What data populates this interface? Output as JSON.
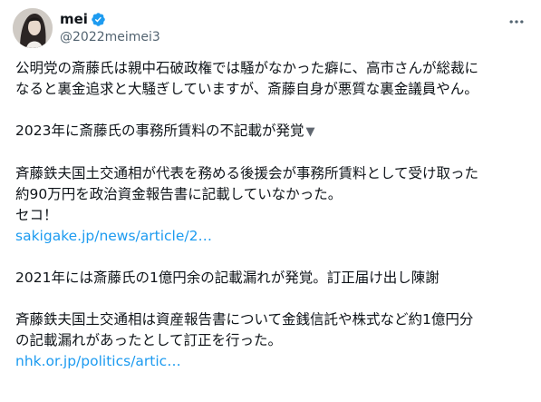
{
  "author": {
    "display_name": "mei",
    "handle": "@2022meimei3"
  },
  "colors": {
    "text": "#0f1419",
    "secondary": "#536471",
    "link": "#1d9bf0",
    "verified": "#1d9bf0"
  },
  "icons": {
    "verified": "verified-badge-icon",
    "more": "more-options-icon",
    "triangle": "down-triangle-icon"
  },
  "post": {
    "para1_line1": "公明党の斎藤氏は親中石破政権では騒がなかった癖に、高市さんが総裁に",
    "para1_line2": "なると裏金追求と大騒ぎしていますが、斎藤自身が悪質な裏金議員やん。",
    "para2_line1": "2023年に斎藤氏の事務所賃料の不記載が発覚",
    "para3_line1": "斉藤鉄夫国土交通相が代表を務める後援会が事務所賃料として受け取った",
    "para3_line2": "約90万円を政治資金報告書に記載していなかった。",
    "para3_line3": "セコ！",
    "link1": "sakigake.jp/news/article/2…",
    "para4_line1": "2021年には斎藤氏の1億円余の記載漏れが発覚。訂正届け出し陳謝",
    "para5_line1": "斉藤鉄夫国土交通相は資産報告書について金銭信託や株式など約1億円分",
    "para5_line2": "の記載漏れがあったとして訂正を行った。",
    "link2": "nhk.or.jp/politics/artic…"
  }
}
